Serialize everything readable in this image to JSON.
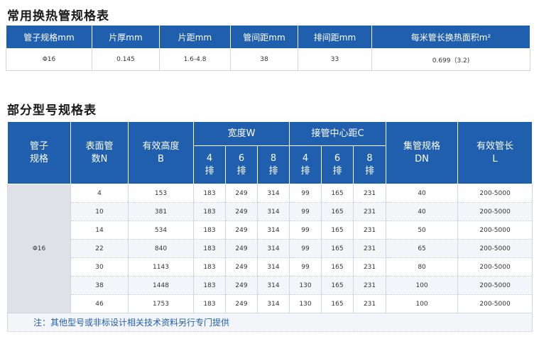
{
  "section1": {
    "title": "常用换热管规格表",
    "headers": [
      "管子规格mm",
      "片厚mm",
      "片距mm",
      "管间距mm",
      "排间距mm",
      "每米管长换热面积m²"
    ],
    "row": [
      "Φ16",
      "0.145",
      "1.6-4.8",
      "38",
      "33",
      "0.699（3.2)"
    ]
  },
  "section2": {
    "title": "部分型号规格表",
    "headers": {
      "pipe_spec": "管子\n规格",
      "surface_tubes": "表面管\n数N",
      "effective_height": "有效高度\nB",
      "width": "宽度W",
      "connection_center": "接管中心距C",
      "header_spec": "集管规格\nDN",
      "effective_length": "有效管长\nL",
      "width_sub": [
        "4\n排",
        "6\n排",
        "8\n排"
      ],
      "conn_sub": [
        "4\n排",
        "6\n排",
        "8\n排"
      ]
    },
    "model": "Φ16",
    "rows": [
      [
        "4",
        "153",
        "183",
        "249",
        "314",
        "99",
        "165",
        "231",
        "40",
        "200-5000"
      ],
      [
        "10",
        "381",
        "183",
        "249",
        "314",
        "99",
        "165",
        "231",
        "40",
        "200-5000"
      ],
      [
        "14",
        "534",
        "183",
        "249",
        "314",
        "99",
        "165",
        "231",
        "50",
        "200-5000"
      ],
      [
        "22",
        "840",
        "183",
        "249",
        "314",
        "99",
        "165",
        "231",
        "65",
        "200-5000"
      ],
      [
        "30",
        "1143",
        "183",
        "249",
        "314",
        "99",
        "165",
        "231",
        "80",
        "200-5000"
      ],
      [
        "38",
        "1448",
        "183",
        "249",
        "314",
        "130",
        "165",
        "231",
        "100",
        "200-5000"
      ],
      [
        "46",
        "1753",
        "183",
        "249",
        "314",
        "130",
        "165",
        "231",
        "100",
        "200-5000"
      ]
    ],
    "note": "注：其他型号或非标设计相关技术资料另行专门提供"
  }
}
